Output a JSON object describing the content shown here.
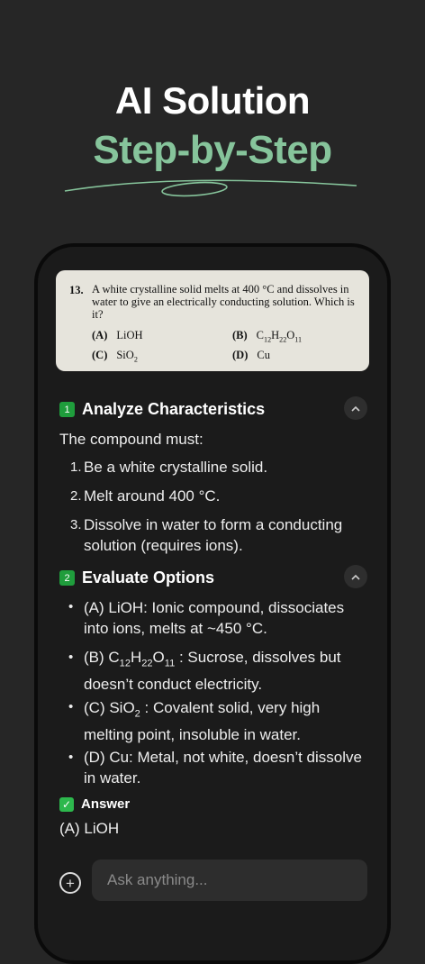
{
  "hero": {
    "title": "AI Solution",
    "subtitle": "Step-by-Step"
  },
  "colors": {
    "accent": "#86c49b",
    "badge_green": "#1f9d3c",
    "check_green": "#2db84d"
  },
  "question": {
    "number": "13.",
    "text": "A white crystalline solid melts at 400 °C and dissolves in water to give an electrically conducting solution. Which is it?",
    "options": [
      {
        "key": "(A)",
        "label": "LiOH"
      },
      {
        "key": "(B)",
        "label": "C12H22O11"
      },
      {
        "key": "(C)",
        "label": "SiO2"
      },
      {
        "key": "(D)",
        "label": "Cu"
      }
    ]
  },
  "steps": [
    {
      "badge": "1",
      "title": "Analyze Characteristics",
      "intro": "The compound must:",
      "items": [
        {
          "marker": "1.",
          "text": "Be a white crystalline solid."
        },
        {
          "marker": "2.",
          "text": "Melt around 400 °C."
        },
        {
          "marker": "3.",
          "text": "Dissolve in water to form a conducting solution (requires ions)."
        }
      ]
    },
    {
      "badge": "2",
      "title": "Evaluate Options",
      "items": [
        {
          "marker": "•",
          "text": "(A) LiOH: Ionic compound, dissociates into ions, melts at ~450 °C."
        },
        {
          "marker": "•",
          "text": "(B) C12H22O11 : Sucrose, dissolves but doesn’t conduct electricity."
        },
        {
          "marker": "•",
          "text": "(C) SiO2 : Covalent solid, very high melting point, insoluble in water."
        },
        {
          "marker": "•",
          "text": "(D) Cu: Metal, not white, doesn’t dissolve in water."
        }
      ]
    }
  ],
  "answer": {
    "label": "Answer",
    "value": "(A) LiOH"
  },
  "composer": {
    "placeholder": "Ask anything..."
  }
}
